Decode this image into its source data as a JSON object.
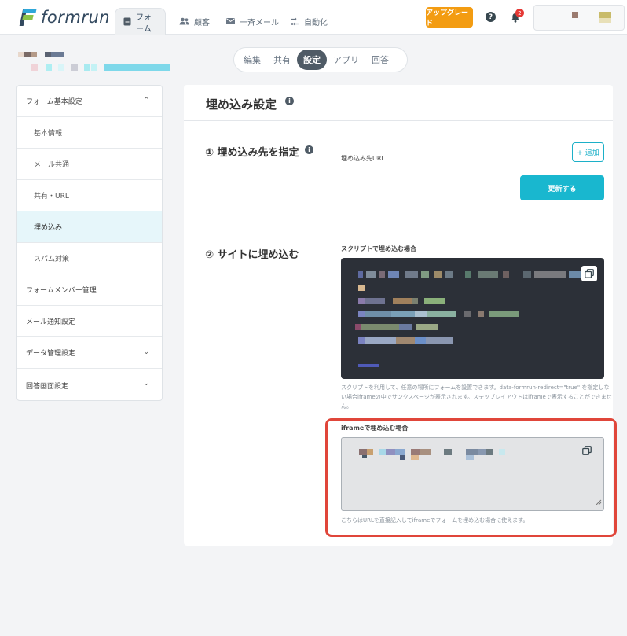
{
  "header": {
    "logo_text": "formrun",
    "nav": [
      {
        "label": "フォーム",
        "icon": "form-icon",
        "active": true
      },
      {
        "label": "顧客",
        "icon": "people-icon"
      },
      {
        "label": "一斉メール",
        "icon": "mail-icon"
      },
      {
        "label": "自動化",
        "icon": "automation-icon"
      }
    ],
    "upgrade_label": "アップグレード",
    "help_icon": "?",
    "notification_count": "2"
  },
  "segment_tabs": [
    {
      "label": "編集"
    },
    {
      "label": "共有"
    },
    {
      "label": "設定",
      "active": true
    },
    {
      "label": "アプリ"
    },
    {
      "label": "回答"
    }
  ],
  "sidebar": {
    "items": [
      {
        "label": "フォーム基本設定",
        "chevron": "⌃"
      },
      {
        "label": "基本情報"
      },
      {
        "label": "メール共通"
      },
      {
        "label": "共有・URL"
      },
      {
        "label": "埋め込み",
        "selected": true
      },
      {
        "label": "スパム対策"
      },
      {
        "label": "フォームメンバー管理"
      },
      {
        "label": "メール通知設定"
      },
      {
        "label": "データ管理設定",
        "chevron": "⌄"
      },
      {
        "label": "回答画面設定",
        "chevron": "⌄"
      }
    ]
  },
  "main": {
    "title": "埋め込み設定",
    "section1": {
      "title": "① 埋め込み先を指定",
      "url_label": "埋め込み先URL",
      "add_button": "+ 追加",
      "update_button": "更新する"
    },
    "section2": {
      "title": "② サイトに埋め込む",
      "script_label": "スクリプトで埋め込む場合",
      "script_note_1": "スクリプトを利用して、任意の場所にフォームを設置できます。data-formrun-redirect=\"true\" を指定しな",
      "script_note_2": "い場合iframeの中でサンクスページが表示されます。ステップレイアウトはiframeで表示することができません。",
      "iframe_label": "iframeで埋め込む場合",
      "iframe_note": "こちらはURLを直接記入してiframeでフォームを埋め込む場合に使えます。"
    }
  },
  "colors": {
    "accent": "#19b7cf",
    "upgrade": "#f39c12",
    "highlight": "#e0463a",
    "code_bg": "#2c3038"
  }
}
